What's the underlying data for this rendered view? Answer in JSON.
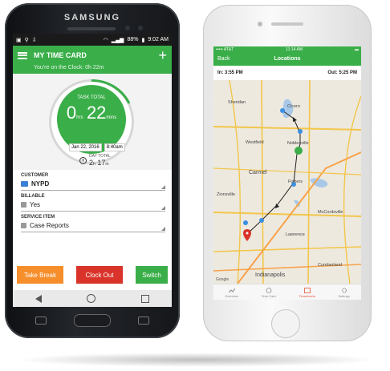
{
  "android": {
    "brand": "SAMSUNG",
    "status": {
      "battery": "88%",
      "time": "9:02 AM"
    },
    "appbar": {
      "title": "MY TIME CARD",
      "subtitle": "You're on the Clock: 0h 22m"
    },
    "task": {
      "label": "TASK TOTAL",
      "hours": "0",
      "hours_unit": "hrs",
      "mins": "22",
      "mins_unit": "mins",
      "date": "Jan 22, 2016",
      "time": "8:40am",
      "day_total_label": "DAY TOTAL",
      "day_total_hours": "2",
      "day_total_mins": "17"
    },
    "fields": {
      "customer_label": "CUSTOMER",
      "customer_value": "NYPD",
      "billable_label": "BILLABLE",
      "billable_value": "Yes",
      "service_label": "SERVICE ITEM",
      "service_value": "Case Reports"
    },
    "buttons": {
      "take_break": "Take Break",
      "clock_out": "Clock Out",
      "switch": "Switch"
    }
  },
  "iphone": {
    "status": {
      "carrier": "••••• AT&T",
      "time": "11:14 AM"
    },
    "nav": {
      "back": "Back",
      "title": "Locations"
    },
    "in_time": "In: 3:55 PM",
    "out_time": "Out: 5:25 PM",
    "cities": {
      "cicero": "Cicero",
      "sheridan": "Sheridan",
      "westfield": "Westfield",
      "noblesville": "Noblesville",
      "carmel": "Carmel",
      "fishers": "Fishers",
      "zionsville": "Zionsville",
      "mccordsville": "McCordsville",
      "lawrence": "Lawrence",
      "indianapolis": "Indianapolis",
      "cumberland": "Cumberland"
    },
    "map_credit": "Google",
    "tabs": {
      "overview": "Overview",
      "timecard": "Time Card",
      "timesheets": "Timesheets",
      "settings": "Settings"
    }
  },
  "colors": {
    "green": "#3aae49",
    "orange": "#f58e2b",
    "red": "#d9332a",
    "blue": "#3c7fd6"
  }
}
